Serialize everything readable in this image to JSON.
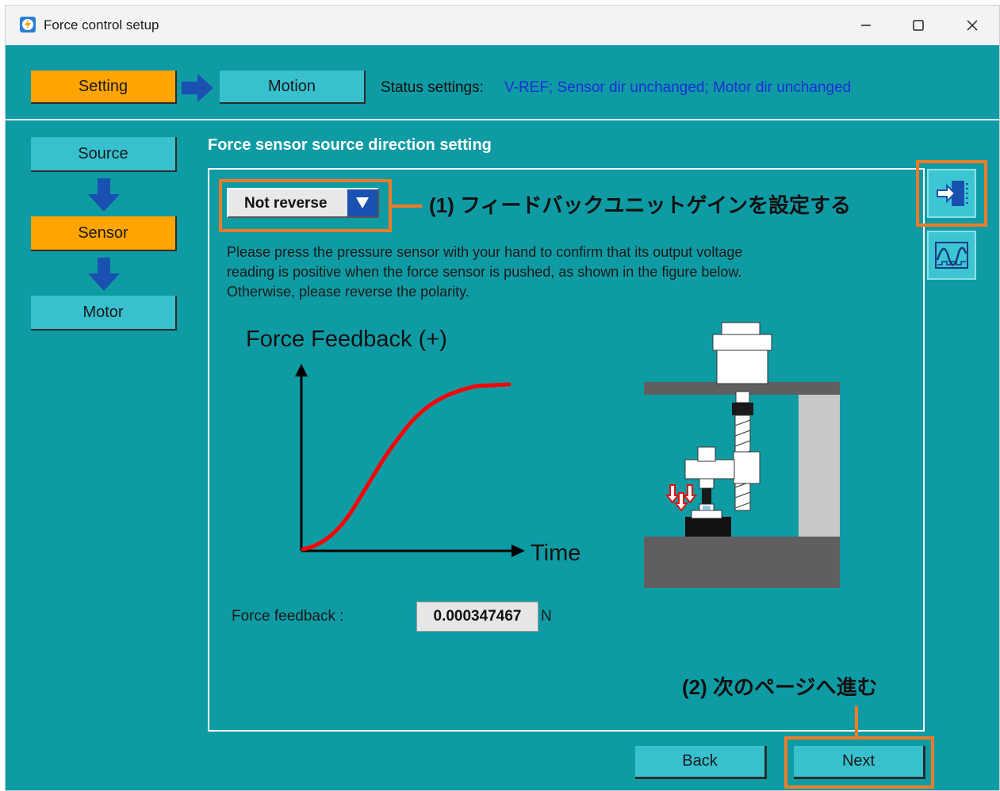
{
  "window": {
    "title": "Force control setup",
    "minimize_icon": "minimize-icon",
    "maximize_icon": "maximize-icon",
    "close_icon": "close-icon"
  },
  "steps": {
    "setting_label": "Setting",
    "motion_label": "Motion",
    "status_label": "Status settings:",
    "status_value": "V-REF; Sensor dir unchanged; Motor dir unchanged"
  },
  "sidebar": {
    "items": [
      {
        "label": "Source"
      },
      {
        "label": "Sensor"
      },
      {
        "label": "Motor"
      }
    ]
  },
  "main": {
    "section_title": "Force sensor source direction setting",
    "direction_select": {
      "value": "Not reverse"
    },
    "description": [
      "Please press the pressure sensor with your hand to confirm that its output voltage",
      "reading is positive when the force sensor is pushed, as shown in the figure below.",
      "Otherwise, please reverse the polarity."
    ],
    "figure": {
      "title": "Force Feedback (+)",
      "x_label": "Time"
    },
    "force_feedback": {
      "label": "Force feedback :",
      "value": "0.000347467",
      "unit": "N"
    }
  },
  "annotations": {
    "step1": "(1) フィードバックユニットゲインを設定する",
    "step2": "(2) 次のページへ進む"
  },
  "footer": {
    "back_label": "Back",
    "next_label": "Next"
  },
  "colors": {
    "background": "#0f9ba4",
    "active_step": "#ffa400",
    "inactive_step": "#38c0cf",
    "status_text": "#1a2fd6",
    "annotation_frame": "#f07b27",
    "curve": "#ff0000"
  },
  "icons": [
    "app-icon",
    "arrow-right-icon",
    "arrow-down-icon",
    "import-to-device-icon",
    "waveform-icon",
    "dropdown-arrow-icon"
  ]
}
